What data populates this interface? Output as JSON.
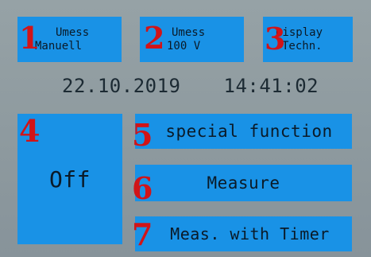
{
  "top_buttons": [
    {
      "number": "1",
      "line1": "Umess",
      "line2": "Manuell"
    },
    {
      "number": "2",
      "line1": "Umess",
      "line2": "100 V"
    },
    {
      "number": "3",
      "line1": "Display",
      "line2": "Techn."
    }
  ],
  "status": {
    "date": "22.10.2019",
    "time": "14:41:02"
  },
  "off_button": {
    "number": "4",
    "label": "Off"
  },
  "menu": [
    {
      "number": "5",
      "label": "special function"
    },
    {
      "number": "6",
      "label": "Measure"
    },
    {
      "number": "7",
      "label": "Meas. with Timer"
    }
  ],
  "colors": {
    "button": "#1992e6",
    "background": "#8d999e",
    "number_marker": "#d11418",
    "text": "#0a1a28"
  }
}
